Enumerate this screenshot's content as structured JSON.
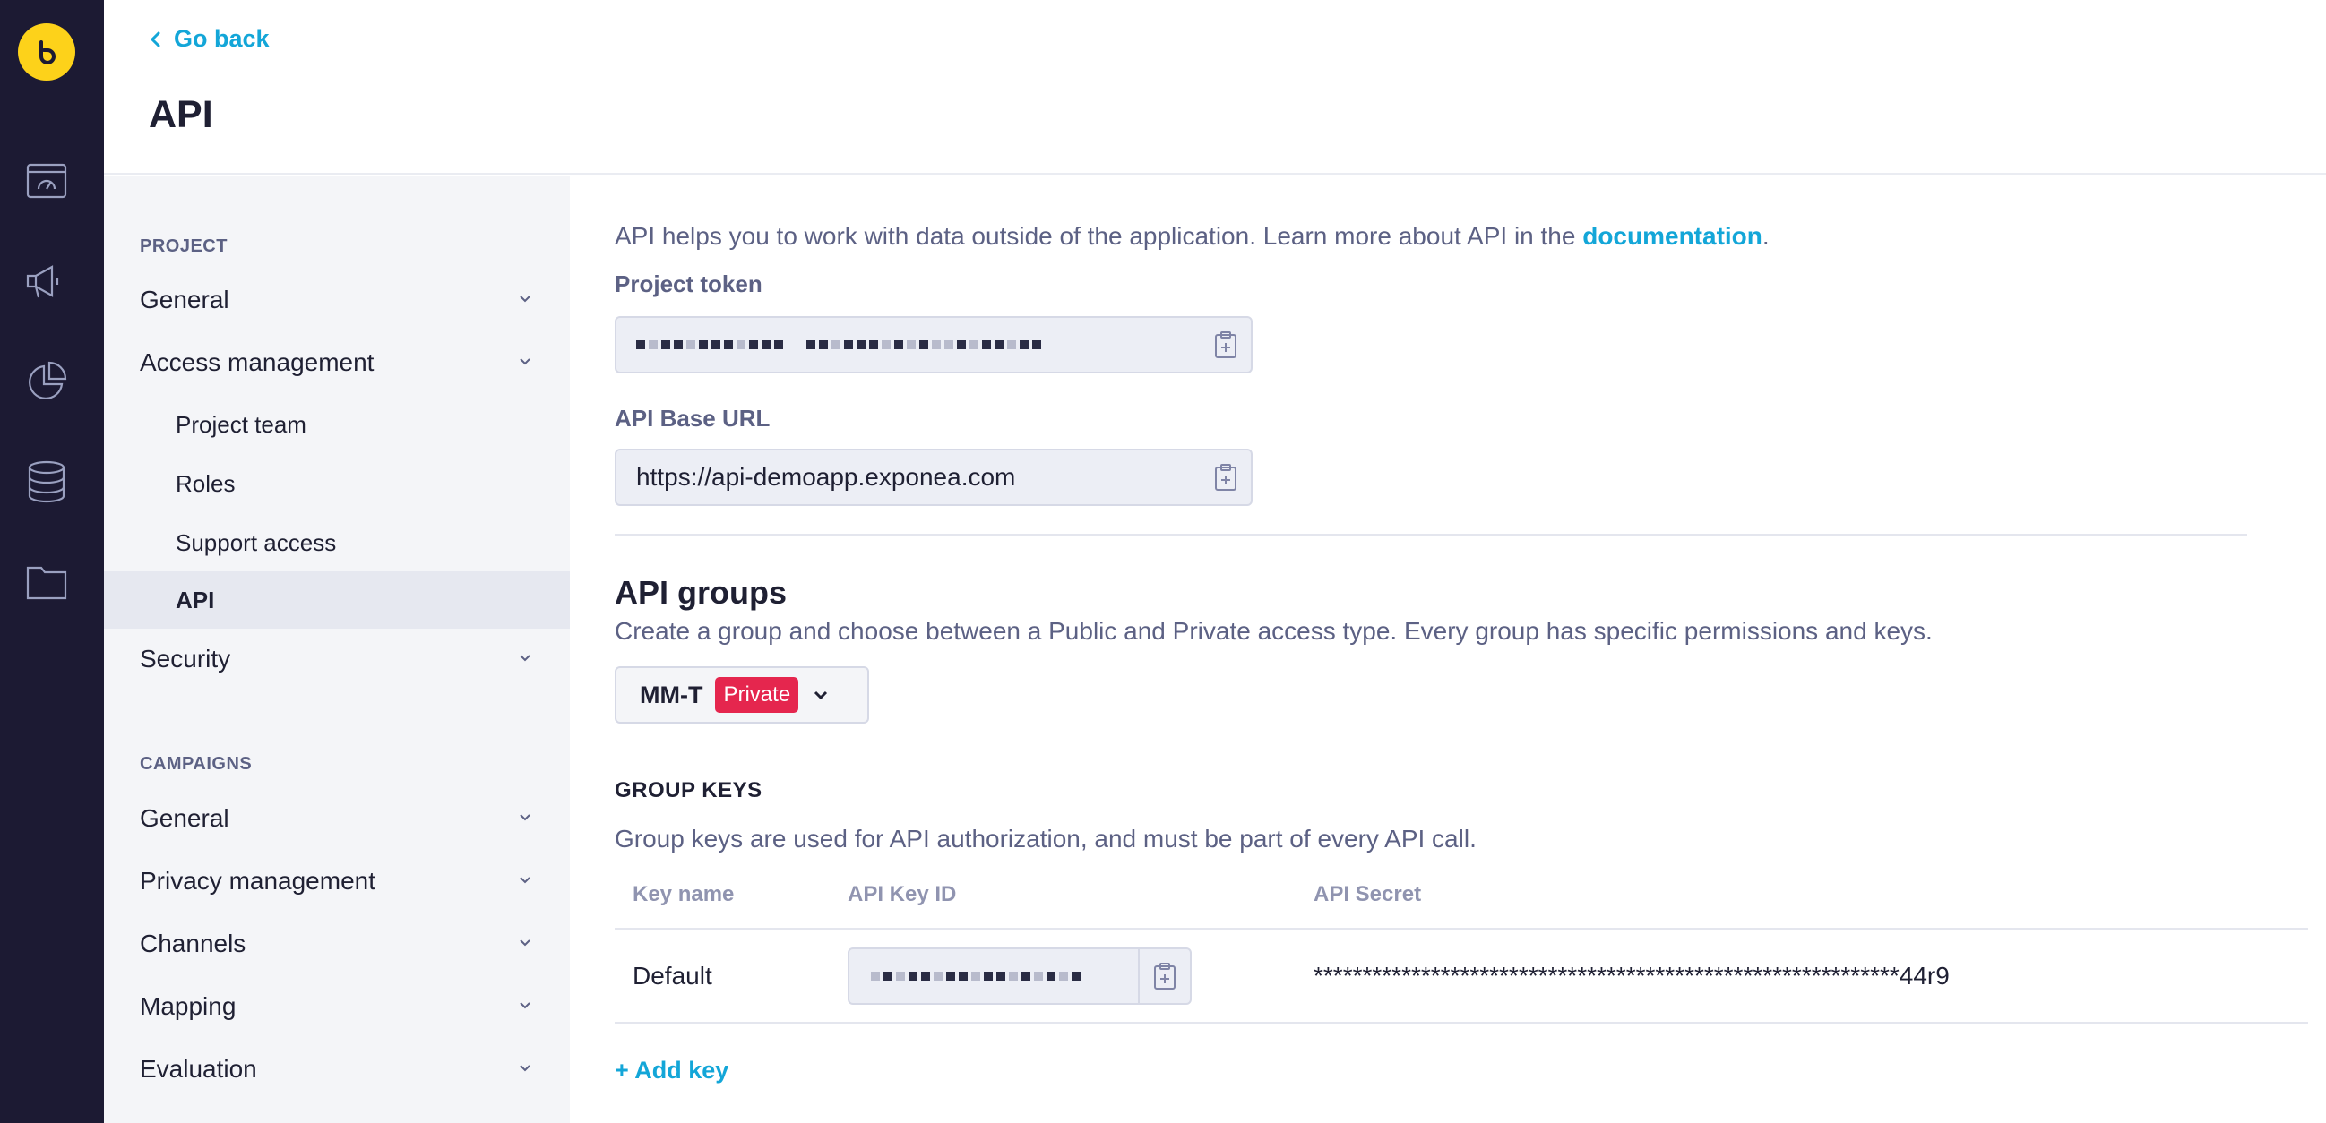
{
  "header": {
    "back_label": "Go back",
    "title": "API"
  },
  "sidebar": {
    "project_section": "PROJECT",
    "project_items": {
      "general": "General",
      "access_management": "Access management",
      "project_team": "Project team",
      "roles": "Roles",
      "support_access": "Support access",
      "api": "API",
      "security": "Security"
    },
    "campaigns_section": "CAMPAIGNS",
    "campaign_items": {
      "general": "General",
      "privacy_management": "Privacy management",
      "channels": "Channels",
      "mapping": "Mapping",
      "evaluation": "Evaluation"
    }
  },
  "main": {
    "intro_text": "API helps you to work with data outside of the application. Learn more about API in the ",
    "intro_link": "documentation",
    "intro_end": ".",
    "project_token_label": "Project token",
    "api_base_url_label": "API Base URL",
    "api_base_url_value": "https://api-demoapp.exponea.com",
    "api_groups_title": "API groups",
    "api_groups_desc": "Create a group and choose between a Public and Private access type. Every group has specific permissions and keys.",
    "group": {
      "name": "MM-T",
      "access_type": "Private"
    },
    "group_keys_title": "GROUP KEYS",
    "group_keys_desc": "Group keys are used for API authorization, and must be part of every API call.",
    "table": {
      "columns": [
        "Key name",
        "API Key ID",
        "API Secret"
      ],
      "rows": [
        {
          "key_name": "Default",
          "api_secret": "************************************************************44r9"
        }
      ]
    },
    "add_key_label": "+ Add key"
  },
  "colors": {
    "rail": "#1c1a33",
    "logo": "#fdd21a",
    "accent": "#13a6d8",
    "private_badge": "#e5264e",
    "sidebar_bg": "#f4f5f8"
  },
  "icons": {
    "rail": [
      "logo-icon",
      "dashboard-icon",
      "campaign-megaphone-icon",
      "analytics-pie-icon",
      "data-database-icon",
      "assets-folder-icon"
    ],
    "copy": "clipboard-copy-icon"
  }
}
